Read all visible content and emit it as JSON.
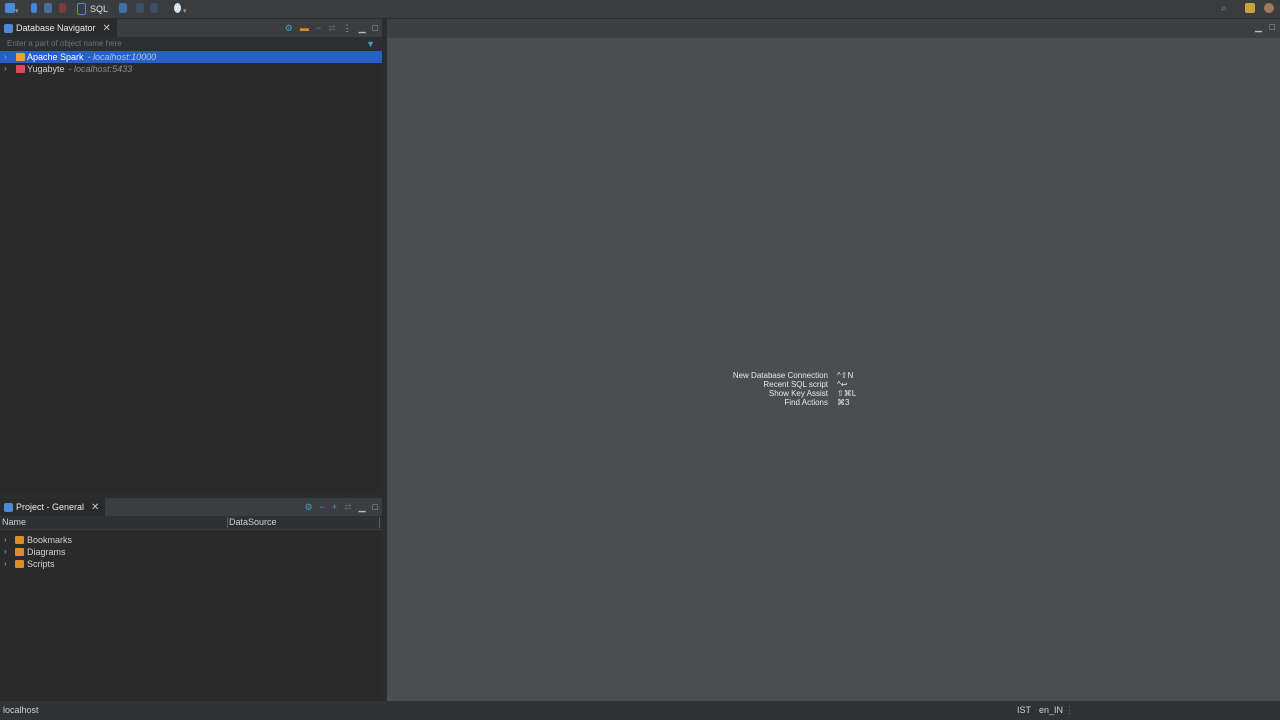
{
  "toolbar": {
    "sql_label": "SQL",
    "icons": [
      "db-connect-icon",
      "disconnect-icon",
      "transaction-icon",
      "rollback-icon",
      "sql-editor-icon",
      "lock-icon",
      "refresh-icon",
      "history-icon",
      "bookmark-icon"
    ],
    "right_icons": [
      "search-icon",
      "perspective-icon",
      "dbeaver-icon"
    ]
  },
  "navigator": {
    "tab_label": "Database Navigator",
    "filter_placeholder": "Enter a part of object name here",
    "items": [
      {
        "name": "Apache Spark",
        "host": "- localhost:10000",
        "selected": true,
        "icon_color": "#e8a23a"
      },
      {
        "name": "Yugabyte",
        "host": "- localhost:5433",
        "selected": false,
        "icon_color": "#d94b5a"
      }
    ]
  },
  "project": {
    "tab_label": "Project - General",
    "columns": [
      "Name",
      "DataSource"
    ],
    "items": [
      {
        "name": "Bookmarks"
      },
      {
        "name": "Diagrams"
      },
      {
        "name": "Scripts"
      }
    ]
  },
  "editor": {
    "shortcuts": [
      {
        "label": "New Database Connection",
        "key": "^⇧N"
      },
      {
        "label": "Recent SQL script",
        "key": "^↩"
      },
      {
        "label": "Show Key Assist",
        "key": "⇧⌘L"
      },
      {
        "label": "Find Actions",
        "key": "⌘3"
      }
    ]
  },
  "status": {
    "left": "localhost",
    "timezone": "IST",
    "locale": "en_IN"
  },
  "colors": {
    "selection": "#2661c9",
    "accent": "#3aa0d8",
    "folder": "#e08a2e"
  }
}
